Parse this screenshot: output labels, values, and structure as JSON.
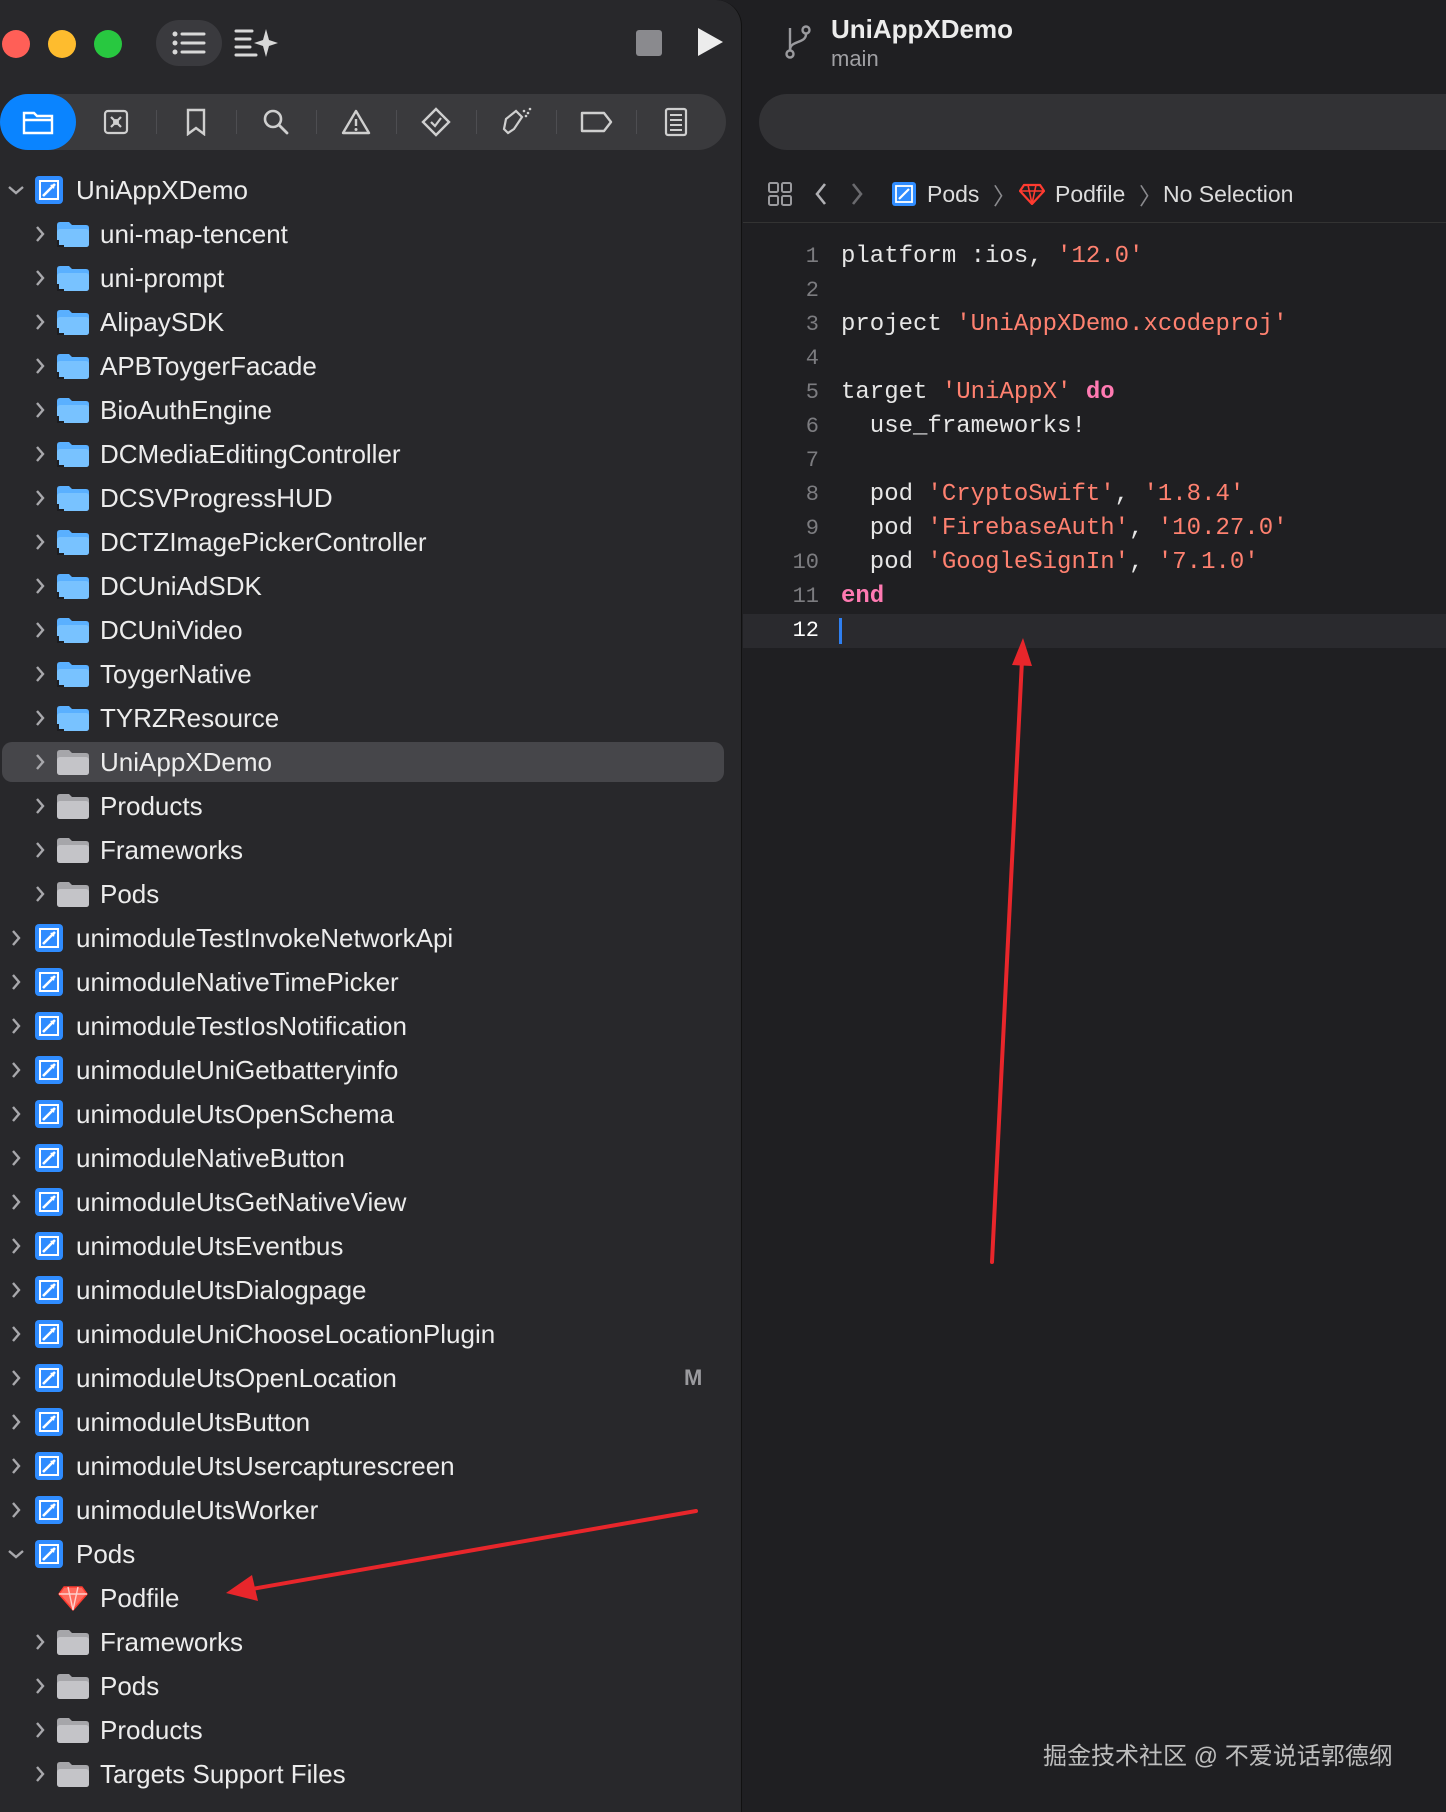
{
  "sidebar": {
    "tree": [
      {
        "label": "UniAppXDemo",
        "kind": "project",
        "level": 0,
        "expanded": true
      },
      {
        "label": "uni-map-tencent",
        "kind": "folder-blue",
        "level": 1
      },
      {
        "label": "uni-prompt",
        "kind": "folder-blue",
        "level": 1
      },
      {
        "label": "AlipaySDK",
        "kind": "folder-blue",
        "level": 1
      },
      {
        "label": "APBToygerFacade",
        "kind": "folder-blue",
        "level": 1
      },
      {
        "label": "BioAuthEngine",
        "kind": "folder-blue",
        "level": 1
      },
      {
        "label": "DCMediaEditingController",
        "kind": "folder-blue",
        "level": 1
      },
      {
        "label": "DCSVProgressHUD",
        "kind": "folder-blue",
        "level": 1
      },
      {
        "label": "DCTZImagePickerController",
        "kind": "folder-blue",
        "level": 1
      },
      {
        "label": "DCUniAdSDK",
        "kind": "folder-blue",
        "level": 1
      },
      {
        "label": "DCUniVideo",
        "kind": "folder-blue",
        "level": 1
      },
      {
        "label": "ToygerNative",
        "kind": "folder-blue",
        "level": 1
      },
      {
        "label": "TYRZResource",
        "kind": "folder-blue",
        "level": 1
      },
      {
        "label": "UniAppXDemo",
        "kind": "folder-grey",
        "level": 1,
        "selected": true
      },
      {
        "label": "Products",
        "kind": "folder-grey",
        "level": 1
      },
      {
        "label": "Frameworks",
        "kind": "folder-grey",
        "level": 1
      },
      {
        "label": "Pods",
        "kind": "folder-grey",
        "level": 1
      },
      {
        "label": "unimoduleTestInvokeNetworkApi",
        "kind": "project",
        "level": 0
      },
      {
        "label": "unimoduleNativeTimePicker",
        "kind": "project",
        "level": 0
      },
      {
        "label": "unimoduleTestIosNotification",
        "kind": "project",
        "level": 0
      },
      {
        "label": "unimoduleUniGetbatteryinfo",
        "kind": "project",
        "level": 0
      },
      {
        "label": "unimoduleUtsOpenSchema",
        "kind": "project",
        "level": 0
      },
      {
        "label": "unimoduleNativeButton",
        "kind": "project",
        "level": 0
      },
      {
        "label": "unimoduleUtsGetNativeView",
        "kind": "project",
        "level": 0
      },
      {
        "label": "unimoduleUtsEventbus",
        "kind": "project",
        "level": 0
      },
      {
        "label": "unimoduleUtsDialogpage",
        "kind": "project",
        "level": 0
      },
      {
        "label": "unimoduleUniChooseLocationPlugin",
        "kind": "project",
        "level": 0
      },
      {
        "label": "unimoduleUtsOpenLocation",
        "kind": "project",
        "level": 0,
        "badge": "M"
      },
      {
        "label": "unimoduleUtsButton",
        "kind": "project",
        "level": 0
      },
      {
        "label": "unimoduleUtsUsercapturescreen",
        "kind": "project",
        "level": 0
      },
      {
        "label": "unimoduleUtsWorker",
        "kind": "project",
        "level": 0
      },
      {
        "label": "Pods",
        "kind": "project",
        "level": 0,
        "expanded": true
      },
      {
        "label": "Podfile",
        "kind": "ruby",
        "level": 1,
        "leaf": true
      },
      {
        "label": "Frameworks",
        "kind": "folder-grey",
        "level": 1
      },
      {
        "label": "Pods",
        "kind": "folder-grey",
        "level": 1
      },
      {
        "label": "Products",
        "kind": "folder-grey",
        "level": 1
      },
      {
        "label": "Targets Support Files",
        "kind": "folder-grey",
        "level": 1
      }
    ]
  },
  "editor": {
    "project_name": "UniAppXDemo",
    "branch": "main",
    "breadcrumb": {
      "pods": "Pods",
      "file": "Podfile",
      "selection": "No Selection"
    },
    "current_line": 12,
    "lines": [
      {
        "n": "1",
        "tokens": [
          {
            "t": "platform :ios, "
          },
          {
            "t": "'12.0'",
            "c": "str"
          }
        ]
      },
      {
        "n": "2",
        "tokens": []
      },
      {
        "n": "3",
        "tokens": [
          {
            "t": "project "
          },
          {
            "t": "'UniAppXDemo.xcodeproj'",
            "c": "str"
          }
        ]
      },
      {
        "n": "4",
        "tokens": []
      },
      {
        "n": "5",
        "tokens": [
          {
            "t": "target "
          },
          {
            "t": "'UniAppX'",
            "c": "str"
          },
          {
            "t": " "
          },
          {
            "t": "do",
            "c": "kw"
          }
        ]
      },
      {
        "n": "6",
        "tokens": [
          {
            "t": "  use_frameworks!"
          }
        ]
      },
      {
        "n": "7",
        "tokens": []
      },
      {
        "n": "8",
        "tokens": [
          {
            "t": "  pod "
          },
          {
            "t": "'CryptoSwift'",
            "c": "str"
          },
          {
            "t": ", "
          },
          {
            "t": "'1.8.4'",
            "c": "str"
          }
        ]
      },
      {
        "n": "9",
        "tokens": [
          {
            "t": "  pod "
          },
          {
            "t": "'FirebaseAuth'",
            "c": "str"
          },
          {
            "t": ", "
          },
          {
            "t": "'10.27.0'",
            "c": "str"
          }
        ]
      },
      {
        "n": "10",
        "tokens": [
          {
            "t": "  pod "
          },
          {
            "t": "'GoogleSignIn'",
            "c": "str"
          },
          {
            "t": ", "
          },
          {
            "t": "'7.1.0'",
            "c": "str"
          }
        ]
      },
      {
        "n": "11",
        "tokens": [
          {
            "t": "end",
            "c": "kw"
          }
        ]
      },
      {
        "n": "12",
        "tokens": []
      }
    ]
  },
  "watermark": "掘金技术社区 @ 不爱说话郭德纲",
  "colors": {
    "accent": "#0a84ff",
    "annotation_arrow": "#e8262b",
    "string": "#ff8170",
    "keyword": "#ff7ab2"
  }
}
